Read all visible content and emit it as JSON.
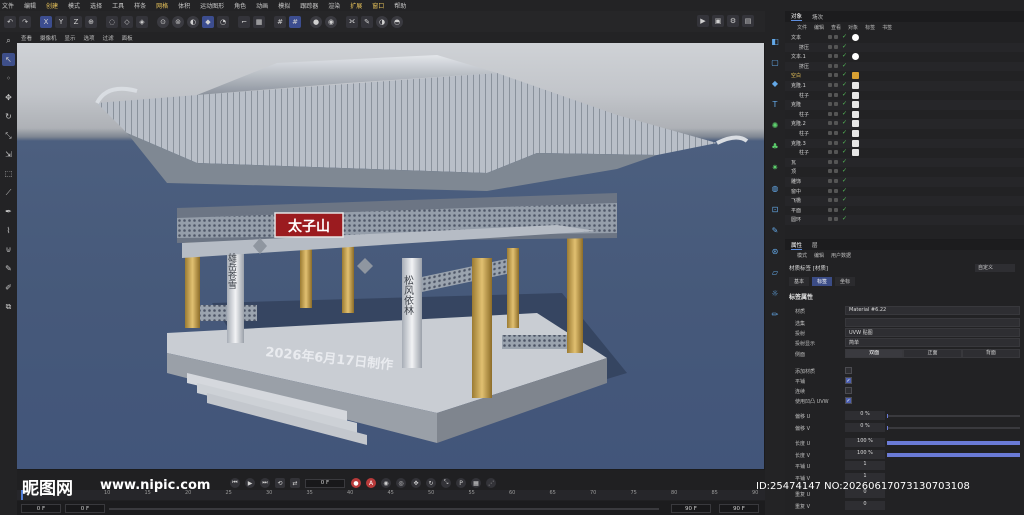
{
  "menubar": [
    "文件",
    "编辑",
    "创建",
    "模式",
    "选择",
    "工具",
    "样条",
    "网格",
    "体积",
    "运动图形",
    "角色",
    "动画",
    "模拟",
    "跟踪器",
    "渲染",
    "扩展",
    "窗口",
    "帮助"
  ],
  "menubar_highlight": [
    "创建",
    "网格",
    "扩展",
    "窗口"
  ],
  "toolbar": {
    "axes": [
      "X",
      "Y",
      "Z"
    ],
    "icons": [
      "undo-icon",
      "move-icon",
      "rotate-icon",
      "scale-icon",
      "render-view-icon",
      "render-icon"
    ]
  },
  "viewport_menu": [
    "查看",
    "摄像机",
    "显示",
    "选项",
    "过滤",
    "面板"
  ],
  "scene": {
    "plaque_text": "太子山",
    "ground_text": "2026年6月17日制作",
    "pillar_text_left": "雄岳苍雪",
    "pillar_text_right": "松风依林"
  },
  "watermark": {
    "brand": "昵图网",
    "url": "www.nipic.com",
    "id": "ID:25474147 NO:20260617073130703108"
  },
  "timeline": {
    "ticks": [
      "0",
      "5",
      "10",
      "15",
      "20",
      "25",
      "30",
      "35",
      "40",
      "45",
      "50",
      "55",
      "60",
      "65",
      "70",
      "75",
      "80",
      "85",
      "90"
    ],
    "current_frame": "0 F",
    "start": "0 F",
    "start2": "0 F",
    "end": "90 F",
    "end2": "90 F"
  },
  "object_manager": {
    "tabs": [
      "对象",
      "场次"
    ],
    "menu": [
      "文件",
      "编辑",
      "查看",
      "对象",
      "标签",
      "书签"
    ],
    "rows": [
      {
        "name": "文本",
        "indent": 0,
        "tag": "c"
      },
      {
        "name": "挤压",
        "indent": 1,
        "tag": ""
      },
      {
        "name": "文本.1",
        "indent": 0,
        "tag": "c"
      },
      {
        "name": "挤压",
        "indent": 1,
        "tag": ""
      },
      {
        "name": "空白",
        "indent": 0,
        "tag": "mat",
        "highlight": true
      },
      {
        "name": "克隆.1",
        "indent": 0,
        "tag": "w"
      },
      {
        "name": "柱子",
        "indent": 1,
        "tag": "w"
      },
      {
        "name": "克隆",
        "indent": 0,
        "tag": "w"
      },
      {
        "name": "柱子",
        "indent": 1,
        "tag": "w"
      },
      {
        "name": "克隆.2",
        "indent": 0,
        "tag": "w"
      },
      {
        "name": "柱子",
        "indent": 1,
        "tag": "w"
      },
      {
        "name": "克隆.3",
        "indent": 0,
        "tag": "w"
      },
      {
        "name": "柱子",
        "indent": 1,
        "tag": "w"
      },
      {
        "name": "瓦",
        "indent": 0,
        "tag": ""
      },
      {
        "name": "顶",
        "indent": 0,
        "tag": ""
      },
      {
        "name": "雕饰",
        "indent": 0,
        "tag": ""
      },
      {
        "name": "窗中",
        "indent": 0,
        "tag": ""
      },
      {
        "name": "飞檐",
        "indent": 0,
        "tag": ""
      },
      {
        "name": "平面",
        "indent": 0,
        "tag": ""
      },
      {
        "name": "圆环",
        "indent": 0,
        "tag": ""
      }
    ]
  },
  "attributes": {
    "tabs": [
      "属性",
      "层"
    ],
    "menu": [
      "模式",
      "编辑",
      "用户数据"
    ],
    "title": "材质标签 [材质]",
    "mode": "自定义",
    "subtabs": [
      "基本",
      "标签",
      "坐标"
    ],
    "active_subtab": "标签",
    "section": "标签属性",
    "material_label": "材质",
    "material": "Material #6.22",
    "selection_label": "选集",
    "projection_label": "投射",
    "projection": "UVW 贴图",
    "projection_display_label": "投射显示",
    "projection_display": "简单",
    "side_label": "侧面",
    "sides": [
      "双面",
      "正面",
      "背面"
    ],
    "checks": [
      {
        "label": "添加材质",
        "on": false
      },
      {
        "label": "平铺",
        "on": true
      },
      {
        "label": "连续",
        "on": false
      },
      {
        "label": "使用凹凸 UVW",
        "on": true
      }
    ],
    "offset_u_label": "偏移 U",
    "offset_u": "0 %",
    "offset_v_label": "偏移 V",
    "offset_v": "0 %",
    "length_u_label": "长度 U",
    "length_u": "100 %",
    "length_v_label": "长度 V",
    "length_v": "100 %",
    "tile_u_label": "平铺 U",
    "tile_u": "1",
    "tile_v_label": "平铺 V",
    "tile_v": "1",
    "repeat_u_label": "重复 U",
    "repeat_u": "0",
    "repeat_v_label": "重复 V",
    "repeat_v": "0"
  },
  "colors": {
    "accent": "#3c4d8f",
    "highlight_menu": "#e8c35a",
    "checkmark": "#56c25a",
    "floor": "#4a5d80",
    "plaque": "#9b1b1f"
  }
}
